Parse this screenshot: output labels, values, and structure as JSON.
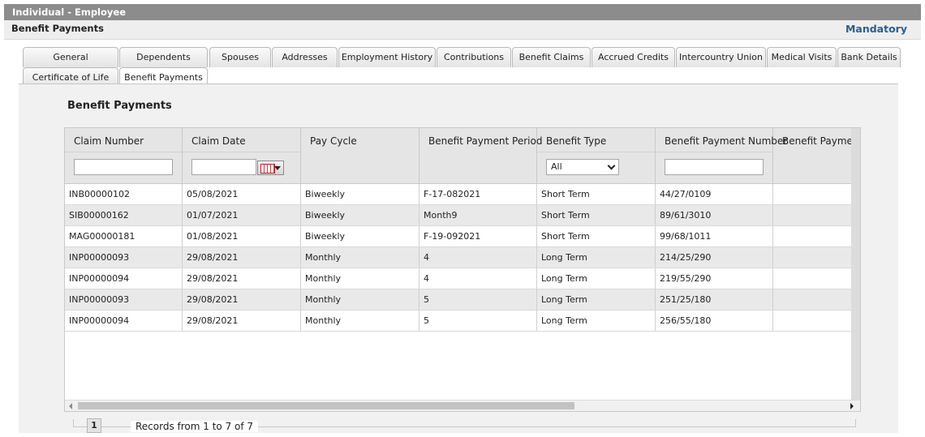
{
  "window": {
    "title": "Individual - Employee"
  },
  "header": {
    "subtitle": "Benefit Payments",
    "mandatory_label": "Mandatory"
  },
  "tabs_row1": [
    "General",
    "Dependents",
    "Spouses",
    "Addresses",
    "Employment History",
    "Contributions",
    "Benefit Claims",
    "Accrued Credits",
    "Intercountry Union",
    "Medical Visits",
    "Bank Details"
  ],
  "tabs_row2": [
    "Certificate of Life",
    "Benefit Payments"
  ],
  "active_tab": "Benefit Payments",
  "section": {
    "title": "Benefit Payments"
  },
  "grid": {
    "columns": [
      "Claim Number",
      "Claim Date",
      "Pay Cycle",
      "Benefit Payment Period",
      "Benefit Type",
      "Benefit Payment Number",
      "Benefit Payment"
    ],
    "filters": {
      "claim_number": "",
      "claim_date": "",
      "benefit_type": "All",
      "benefit_payment_number": ""
    },
    "rows": [
      [
        "INB00000102",
        "05/08/2021",
        "Biweekly",
        "F-17-082021",
        "Short Term",
        "44/27/0109",
        ""
      ],
      [
        "SIB00000162",
        "01/07/2021",
        "Biweekly",
        "Month9",
        "Short Term",
        "89/61/3010",
        ""
      ],
      [
        "MAG00000181",
        "01/08/2021",
        "Biweekly",
        "F-19-092021",
        "Short Term",
        "99/68/1011",
        ""
      ],
      [
        "INP00000093",
        "29/08/2021",
        "Monthly",
        "4",
        "Long Term",
        "214/25/290",
        ""
      ],
      [
        "INP00000094",
        "29/08/2021",
        "Monthly",
        "4",
        "Long Term",
        "219/55/290",
        ""
      ],
      [
        "INP00000093",
        "29/08/2021",
        "Monthly",
        "5",
        "Long Term",
        "251/25/180",
        ""
      ],
      [
        "INP00000094",
        "29/08/2021",
        "Monthly",
        "5",
        "Long Term",
        "256/55/180",
        ""
      ]
    ]
  },
  "pager": {
    "current_page": "1",
    "records_text": "Records from 1 to 7 of 7"
  }
}
